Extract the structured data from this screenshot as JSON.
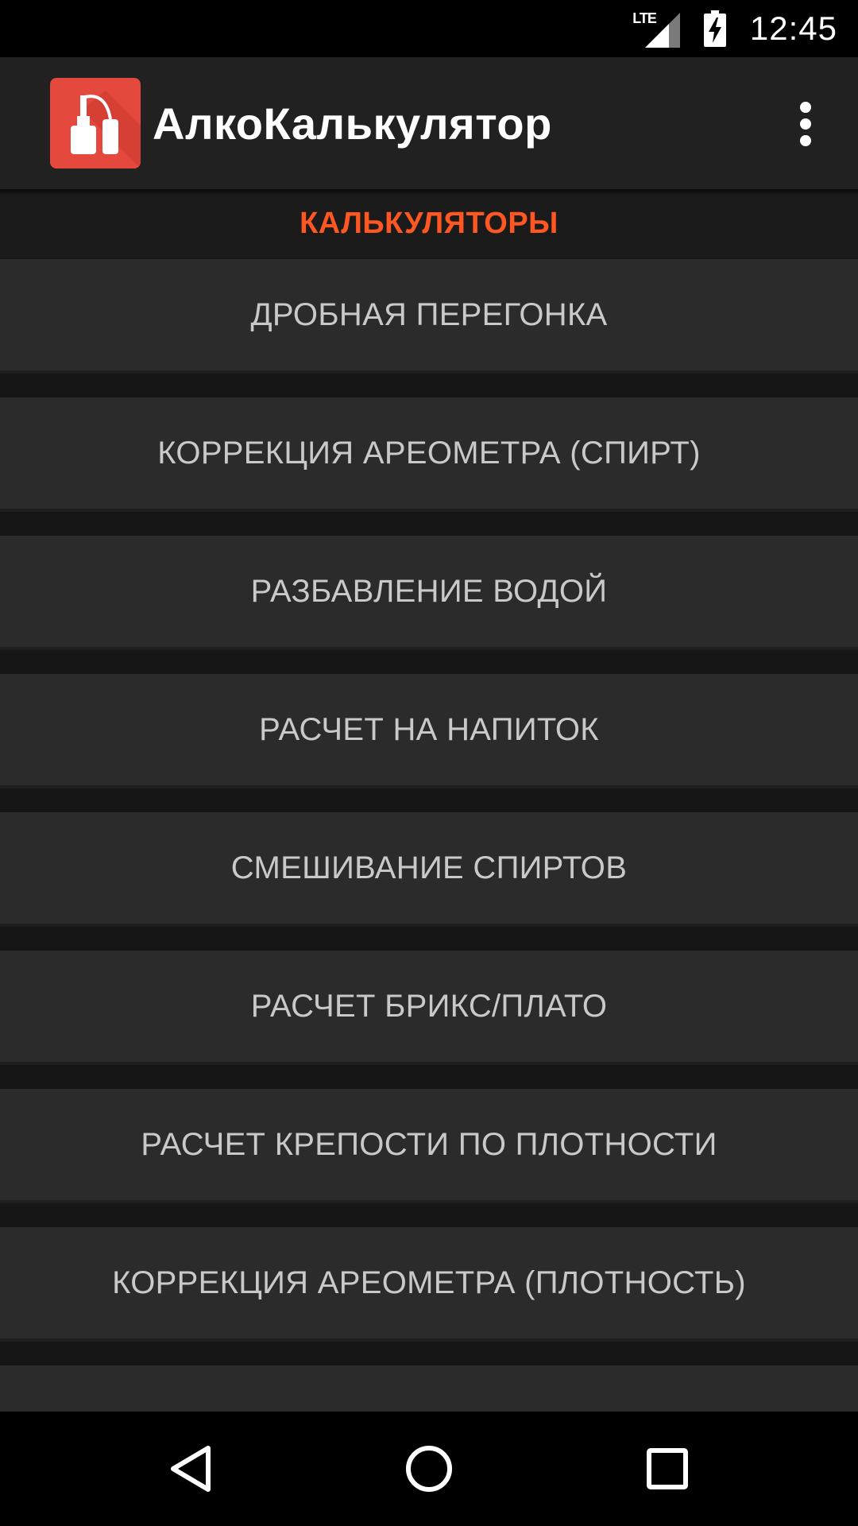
{
  "status_bar": {
    "network": "LTE",
    "time": "12:45"
  },
  "app_bar": {
    "title": "АлкоКалькулятор",
    "icon": "distiller-app-icon",
    "menu_icon": "overflow-menu-icon"
  },
  "section": {
    "header": "КАЛЬКУЛЯТОРЫ"
  },
  "calculators": [
    {
      "label": "ДРОБНАЯ ПЕРЕГОНКА"
    },
    {
      "label": "КОРРЕКЦИЯ АРЕОМЕТРА (СПИРТ)"
    },
    {
      "label": "РАЗБАВЛЕНИЕ ВОДОЙ"
    },
    {
      "label": "РАСЧЕТ НА НАПИТОК"
    },
    {
      "label": "СМЕШИВАНИЕ СПИРТОВ"
    },
    {
      "label": "РАСЧЕТ БРИКС/ПЛАТО"
    },
    {
      "label": "РАСЧЕТ КРЕПОСТИ ПО ПЛОТНОСТИ"
    },
    {
      "label": "КОРРЕКЦИЯ АРЕОМЕТРА (ПЛОТНОСТЬ)"
    },
    {
      "label": ""
    }
  ],
  "nav_bar": {
    "back_icon": "back-icon",
    "home_icon": "home-icon",
    "recents_icon": "recents-icon"
  },
  "colors": {
    "accent": "#ff5722",
    "app_icon_bg": "#e5483c",
    "app_bar_bg": "#212121",
    "button_bg": "#2b2b2b",
    "button_text": "#c9c9c9"
  }
}
